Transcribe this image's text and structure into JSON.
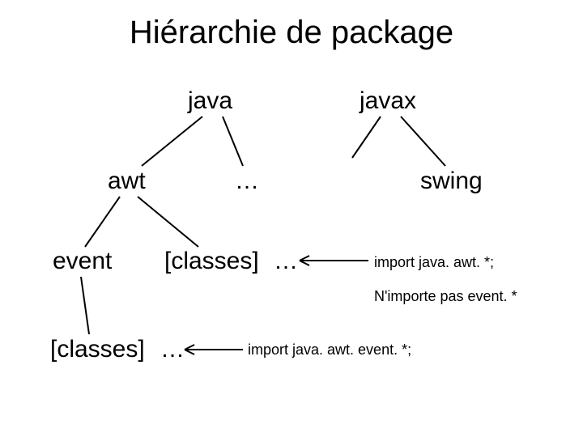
{
  "title": "Hiérarchie de package",
  "nodes": {
    "java": "java",
    "javax": "javax",
    "awt": "awt",
    "dots1": "…",
    "swing": "swing",
    "event": "event",
    "classes1": "[classes]",
    "dots2": "…",
    "import1": "import java. awt. *;",
    "note1": "N'importe pas event. *",
    "classes2": "[classes]",
    "dots3": "…",
    "import2": "import java. awt. event. *;"
  }
}
